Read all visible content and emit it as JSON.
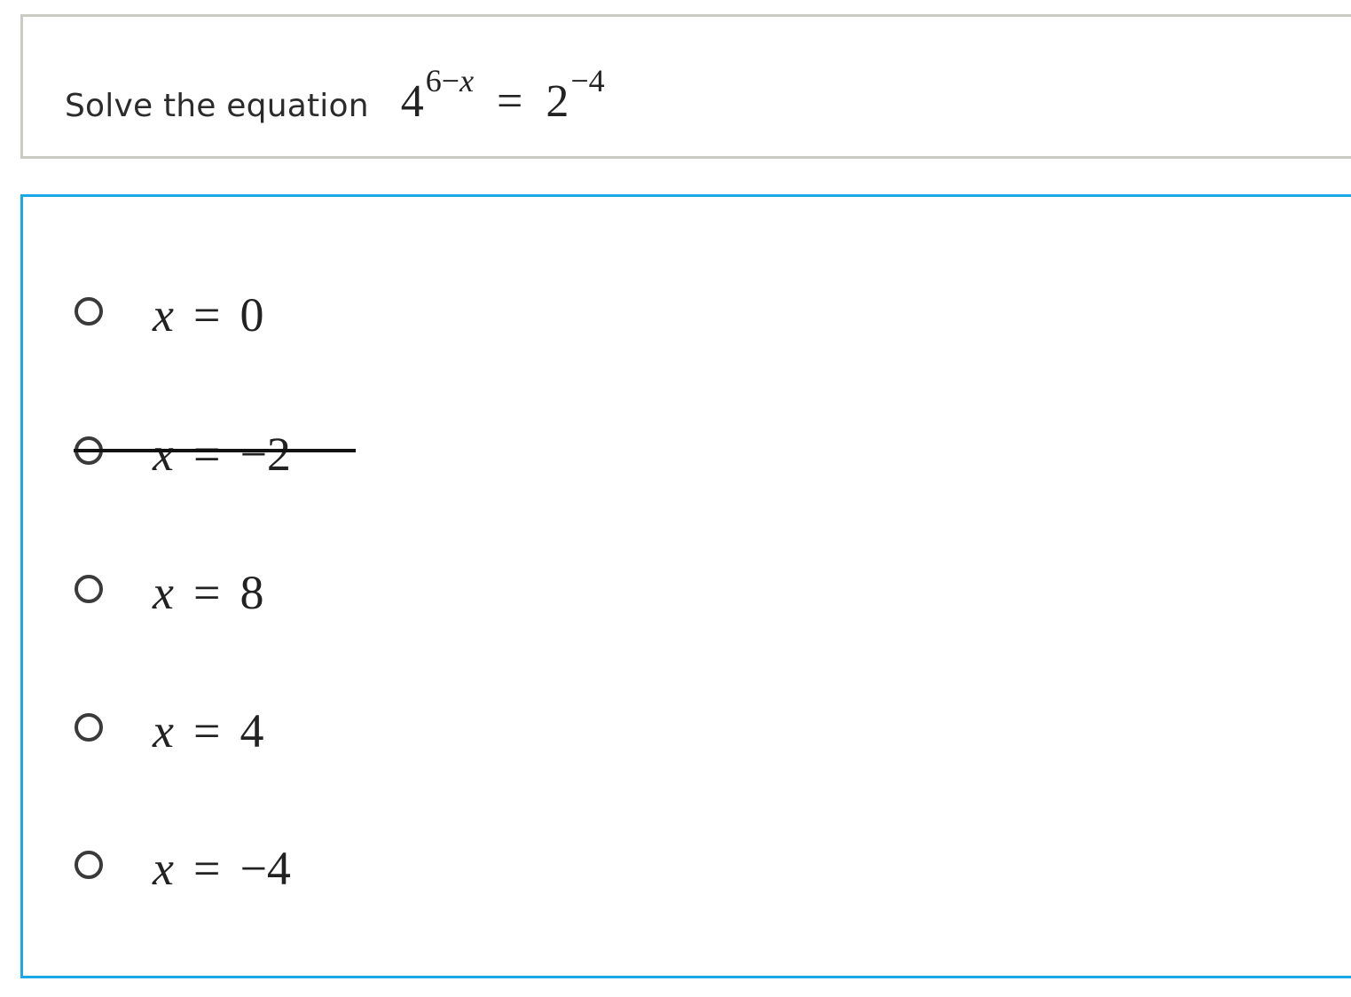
{
  "question": {
    "prompt": "Solve the equation",
    "equation": {
      "base_left": "4",
      "exponent_left_const": "6−",
      "exponent_left_var": "x",
      "equals": "=",
      "base_right": "2",
      "exponent_right": "−4"
    }
  },
  "answers": {
    "options": [
      {
        "variable": "x",
        "equals": "=",
        "value": "0",
        "selected": false,
        "struck_out": false
      },
      {
        "variable": "x",
        "equals": "=",
        "value": "−2",
        "selected": false,
        "struck_out": true
      },
      {
        "variable": "x",
        "equals": "=",
        "value": "8",
        "selected": false,
        "struck_out": false
      },
      {
        "variable": "x",
        "equals": "=",
        "value": "4",
        "selected": false,
        "struck_out": false
      },
      {
        "variable": "x",
        "equals": "=",
        "value": "−4",
        "selected": false,
        "struck_out": false
      }
    ]
  },
  "colors": {
    "question_border": "#cbcbc6",
    "answers_border": "#1aa8e6",
    "text": "#2b2b2b"
  }
}
